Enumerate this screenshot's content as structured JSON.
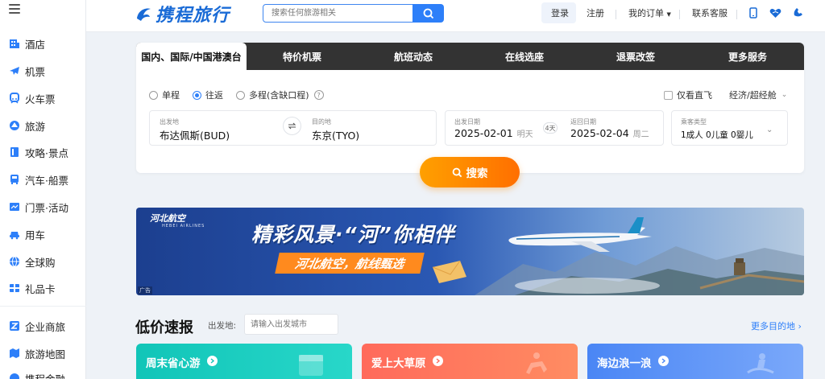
{
  "sidebar": {
    "items": [
      {
        "label": "酒店",
        "icon": "hotel-icon"
      },
      {
        "label": "机票",
        "icon": "plane-icon"
      },
      {
        "label": "火车票",
        "icon": "train-icon"
      },
      {
        "label": "旅游",
        "icon": "travel-icon"
      },
      {
        "label": "攻略·景点",
        "icon": "guide-icon"
      },
      {
        "label": "汽车·船票",
        "icon": "bus-icon"
      },
      {
        "label": "门票·活动",
        "icon": "ticket-icon"
      },
      {
        "label": "用车",
        "icon": "car-icon"
      },
      {
        "label": "全球购",
        "icon": "globe-icon"
      },
      {
        "label": "礼品卡",
        "icon": "giftcard-icon"
      },
      {
        "label": "企业商旅",
        "icon": "business-icon"
      },
      {
        "label": "旅游地图",
        "icon": "map-icon"
      },
      {
        "label": "携程金融",
        "icon": "finance-icon"
      }
    ]
  },
  "header": {
    "logo_text": "携程旅行",
    "search_placeholder": "搜索任何旅游相关",
    "login": "登录",
    "register": "注册",
    "my_orders": "我的订单",
    "customer_service": "联系客服"
  },
  "booking": {
    "tabs": [
      "国内、国际/中国港澳台",
      "特价机票",
      "航班动态",
      "在线选座",
      "退票改签",
      "更多服务"
    ],
    "trip_types": [
      "单程",
      "往返",
      "多程(含缺口程)"
    ],
    "selected_trip": "往返",
    "direct_only": "仅看直飞",
    "cabin": "经济/超经舱",
    "from_label": "出发地",
    "from_value": "布达佩斯(BUD)",
    "to_label": "目的地",
    "to_value": "东京(TYO)",
    "depart_label": "出发日期",
    "depart_date": "2025-02-01",
    "depart_day": "明天",
    "return_label": "返回日期",
    "return_date": "2025-02-04",
    "return_day": "周二",
    "duration": "4天",
    "passenger_label": "乘客类型",
    "passengers": "1成人  0儿童  0婴儿",
    "search_button": "搜索"
  },
  "banner": {
    "airline": "河北航空",
    "airline_en": "HEBEI AIRLINES",
    "slogan": "精彩风景·“河”你相伴",
    "slogan2": "河北航空，航线甄选",
    "ad_tag": "广告"
  },
  "low_price": {
    "title": "低价速报",
    "from_label": "出发地:",
    "from_placeholder": "请输入出发城市",
    "more": "更多目的地",
    "cards": [
      {
        "title": "周末省心游",
        "color_from": "#11c5b8",
        "color_to": "#28d7c9"
      },
      {
        "title": "爱上大草原",
        "color_from": "#ff6a5b",
        "color_to": "#ff8c62"
      },
      {
        "title": "海边浪一浪",
        "color_from": "#4a86f5",
        "color_to": "#7aa8fa"
      }
    ]
  },
  "colors": {
    "accent": "#2d7ff9",
    "orange": "#ff8a00",
    "tab_bg": "#333333"
  }
}
